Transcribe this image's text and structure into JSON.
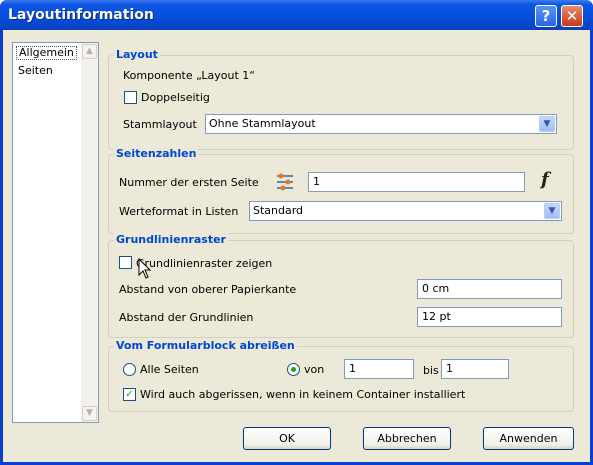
{
  "window": {
    "title": "Layoutinformation",
    "help_label": "?",
    "close_label": "✕"
  },
  "nav": {
    "items": [
      {
        "label": "Allgemein",
        "selected": true
      },
      {
        "label": "Seiten",
        "selected": false
      }
    ]
  },
  "layout_group": {
    "title": "Layout",
    "komponente_text": "Komponente „Layout 1“",
    "doppelseitig_label": "Doppelseitig",
    "doppelseitig_checked": false,
    "stammlayout_label": "Stammlayout",
    "stammlayout_value": "Ohne Stammlayout"
  },
  "seitenzahlen_group": {
    "title": "Seitenzahlen",
    "erste_seite_label": "Nummer der ersten Seite",
    "erste_seite_value": "1",
    "formula_icon": "function-icon",
    "werteformat_label": "Werteformat in Listen",
    "werteformat_value": "Standard"
  },
  "grundlinien_group": {
    "title": "Grundlinienraster",
    "zeigen_label": "Grundlinienraster zeigen",
    "zeigen_checked": false,
    "abstand_oben_label": "Abstand von oberer Papierkante",
    "abstand_oben_value": "0 cm",
    "abstand_linien_label": "Abstand der Grundlinien",
    "abstand_linien_value": "12 pt"
  },
  "formularblock_group": {
    "title": "Vom Formularblock abreißen",
    "alle_seiten_label": "Alle Seiten",
    "alle_seiten_selected": false,
    "von_label": "von",
    "von_selected": true,
    "von_value": "1",
    "bis_label": "bis",
    "bis_value": "1",
    "container_label": "Wird auch abgerissen, wenn in keinem Container installiert",
    "container_checked": true
  },
  "footer": {
    "ok_label": "OK",
    "cancel_label": "Abbrechen",
    "apply_label": "Anwenden"
  },
  "colors": {
    "group_title": "#0046d5",
    "titlebar": "#0650dc",
    "dialog_bg": "#ece9d8"
  }
}
